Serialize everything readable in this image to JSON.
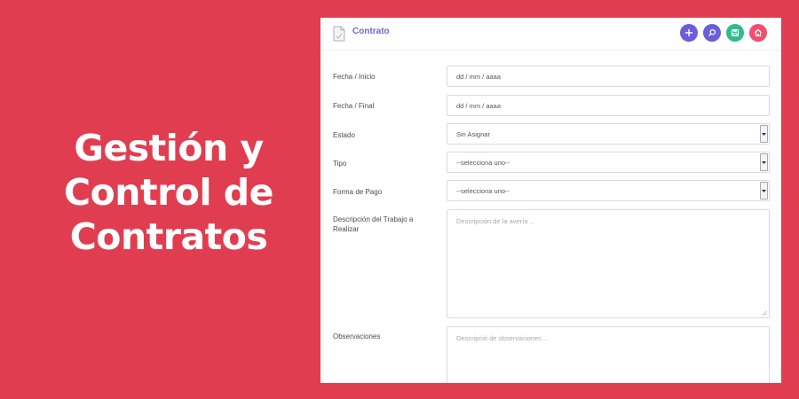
{
  "hero": {
    "line1": "Gestión y",
    "line2": "Control de",
    "line3": "Contratos"
  },
  "header": {
    "title": "Contrato",
    "actions": [
      {
        "name": "add",
        "icon": "plus-icon",
        "color": "#6a5fd6"
      },
      {
        "name": "search",
        "icon": "search-icon",
        "color": "#6a5fd6"
      },
      {
        "name": "save",
        "icon": "save-icon",
        "color": "#2ebc8a"
      },
      {
        "name": "home",
        "icon": "home-icon",
        "color": "#f0506e"
      }
    ]
  },
  "form": {
    "fecha_inicio": {
      "label": "Fecha / Inicio",
      "value": "dd / mm / aaaa"
    },
    "fecha_final": {
      "label": "Fecha / Final",
      "value": "dd / mm / aaaa"
    },
    "estado": {
      "label": "Estado",
      "value": "Sin Asignar"
    },
    "tipo": {
      "label": "Tipo",
      "value": "--selecciona uno--"
    },
    "forma_pago": {
      "label": "Forma de Pago",
      "value": "--selecciona uno--"
    },
    "descripcion": {
      "label": "Descripción del Trabajo a Realizar",
      "placeholder": "Descripción de la avería ..."
    },
    "observaciones": {
      "label": "Observaciones",
      "placeholder": "Descripció de observaciones ..."
    }
  },
  "colors": {
    "background": "#e03e50",
    "accent": "#6f66d6"
  }
}
